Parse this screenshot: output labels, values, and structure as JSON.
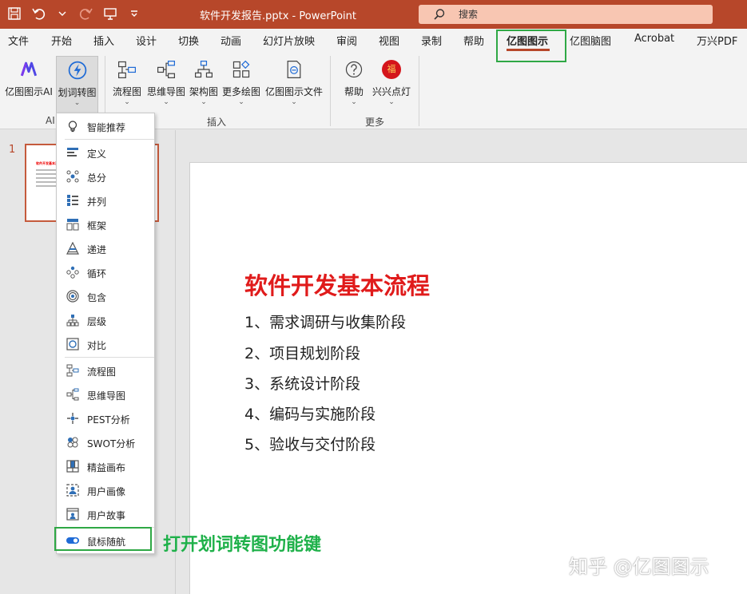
{
  "titlebar": {
    "doc_title": "软件开发报告.pptx  -  PowerPoint",
    "search_placeholder": "搜索"
  },
  "tabs": [
    {
      "label": "文件"
    },
    {
      "label": "开始"
    },
    {
      "label": "插入"
    },
    {
      "label": "设计"
    },
    {
      "label": "切换"
    },
    {
      "label": "动画"
    },
    {
      "label": "幻灯片放映"
    },
    {
      "label": "审阅"
    },
    {
      "label": "视图"
    },
    {
      "label": "录制"
    },
    {
      "label": "帮助"
    },
    {
      "label": "亿图图示"
    },
    {
      "label": "亿图脑图"
    },
    {
      "label": "Acrobat"
    },
    {
      "label": "万兴PDF"
    }
  ],
  "active_tab": "亿图图示",
  "ribbon": {
    "ai_button": "亿图图示AI",
    "convert_button": "划词转图",
    "group_ai": "AI",
    "flowchart": "流程图",
    "mindmap": "思维导图",
    "orgchart": "架构图",
    "more_drawings": "更多绘图",
    "edraw_file": "亿图图示文件",
    "group_insert": "插入",
    "help": "帮助",
    "xingxing": "兴兴点灯",
    "xingxing_badge": "福",
    "group_more": "更多"
  },
  "thumbnail": {
    "number": "1",
    "title": "软件开发基本流程"
  },
  "slide": {
    "title": "软件开发基本流程",
    "items": [
      "1、需求调研与收集阶段",
      "2、项目规划阶段",
      "3、系统设计阶段",
      "4、编码与实施阶段",
      "5、验收与交付阶段"
    ]
  },
  "dropdown": {
    "recommend": "智能推荐",
    "items_group1": [
      "定义",
      "总分",
      "并列",
      "框架",
      "递进",
      "循环",
      "包含",
      "层级",
      "对比"
    ],
    "items_group2": [
      "流程图",
      "思维导图",
      "PEST分析",
      "SWOT分析",
      "精益画布",
      "用户画像",
      "用户故事"
    ],
    "mouse_follow": "鼠标随航"
  },
  "annotation": "打开划词转图功能键",
  "watermark": "知乎 @亿图图示",
  "colors": {
    "titlebar": "#b7472a",
    "highlight_green": "#2fa845",
    "slide_title_red": "#e01b1b",
    "annotation_green": "#1fb14a"
  }
}
